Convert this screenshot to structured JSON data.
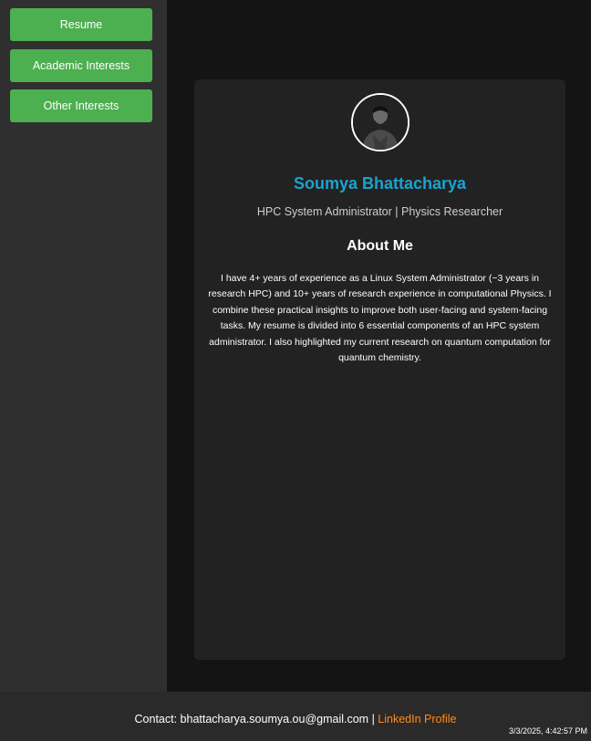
{
  "sidebar": {
    "items": [
      {
        "label": "Resume"
      },
      {
        "label": "Academic Interests"
      },
      {
        "label": "Other Interests"
      }
    ]
  },
  "profile": {
    "name": "Soumya Bhattacharya",
    "subtitle": "HPC System Administrator | Physics Researcher",
    "about_heading": "About Me",
    "about_text": "I have 4+ years of experience as a Linux System Administrator (~3 years in research HPC) and 10+ years of research experience in computational Physics. I combine these practical insights to improve both user-facing and system-facing tasks. My resume is divided into 6 essential components of an HPC system administrator. I also highlighted my current research on quantum computation for quantum chemistry."
  },
  "footer": {
    "contact_prefix": "Contact: bhattacharya.soumya.ou@gmail.com |",
    "linkedin_label": "LinkedIn Profile",
    "timestamp": "3/3/2025, 4:42:57 PM"
  },
  "colors": {
    "accent_button": "#4caf50",
    "name": "#1ca3cf",
    "link": "#ff8c1a"
  }
}
